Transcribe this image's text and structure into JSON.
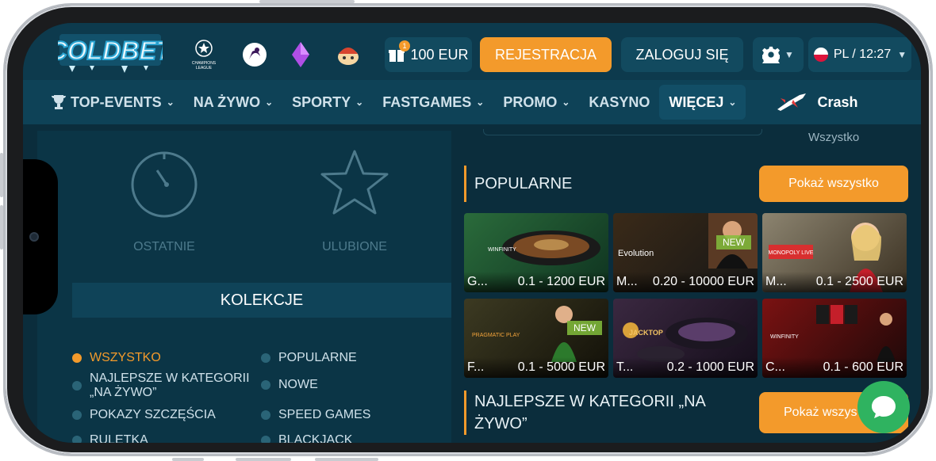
{
  "header": {
    "logo_text": "COLDBET",
    "bonus_label": "100 EUR",
    "bonus_badge": "1",
    "register_label": "REJESTRACJA",
    "login_label": "ZALOGUJ SIĘ",
    "lang_label": "PL / 12:27",
    "league_icons": [
      "champions-league-icon",
      "premier-league-icon",
      "diamond-icon",
      "esport-icon"
    ],
    "champions_text": "CHAMPIONS LEAGUE"
  },
  "nav": {
    "items": [
      {
        "label": "TOP-EVENTS",
        "dropdown": true
      },
      {
        "label": "NA ŻYWO",
        "dropdown": true
      },
      {
        "label": "SPORTY",
        "dropdown": true
      },
      {
        "label": "FASTGAMES",
        "dropdown": true
      },
      {
        "label": "PROMO",
        "dropdown": true
      },
      {
        "label": "KASYNO",
        "dropdown": false
      },
      {
        "label": "WIĘCEJ",
        "dropdown": true
      }
    ],
    "crash_label": "Crash"
  },
  "left": {
    "recent_label": "OSTATNIE",
    "favorites_label": "ULUBIONE",
    "collections_title": "KOLEKCJE",
    "collections": [
      {
        "label": "WSZYSTKO",
        "active": true
      },
      {
        "label": "POPULARNE",
        "active": false
      },
      {
        "label": "NAJLEPSZE W KATEGORII „NA ŻYWO”",
        "active": false
      },
      {
        "label": "NOWE",
        "active": false
      },
      {
        "label": "POKAZY SZCZĘŚCIA",
        "active": false
      },
      {
        "label": "SPEED GAMES",
        "active": false
      },
      {
        "label": "RULETKA",
        "active": false
      },
      {
        "label": "BLACKJACK",
        "active": false
      }
    ]
  },
  "right": {
    "top_filter": "Wszystko",
    "popular_title": "POPULARNE",
    "show_all": "Pokaż wszystko",
    "show_all_2": "Pokaż wszys",
    "live_title": "NAJLEPSZE W KATEGORII „NA ŻYWO”",
    "games": [
      {
        "short": "G...",
        "range": "0.1 - 1200 EUR",
        "provider": "WINFINITY",
        "new": false
      },
      {
        "short": "M...",
        "range": "0.20 - 10000 EUR",
        "provider": "Evolution",
        "new": true
      },
      {
        "short": "M...",
        "range": "0.1 - 2500 EUR",
        "provider": "MONOPOLY LIVE",
        "new": false
      },
      {
        "short": "F...",
        "range": "0.1 - 5000 EUR",
        "provider": "PRAGMATIC PLAY",
        "new": true
      },
      {
        "short": "T...",
        "range": "0.2 - 1000 EUR",
        "provider": "JACKTOP",
        "new": false
      },
      {
        "short": "C...",
        "range": "0.1 - 600 EUR",
        "provider": "WINFINITY",
        "new": false
      }
    ],
    "new_label": "NEW"
  },
  "colors": {
    "accent": "#f39a2b",
    "bg": "#0b2d3c",
    "header": "#0d3a4d",
    "chat": "#2fb360"
  }
}
